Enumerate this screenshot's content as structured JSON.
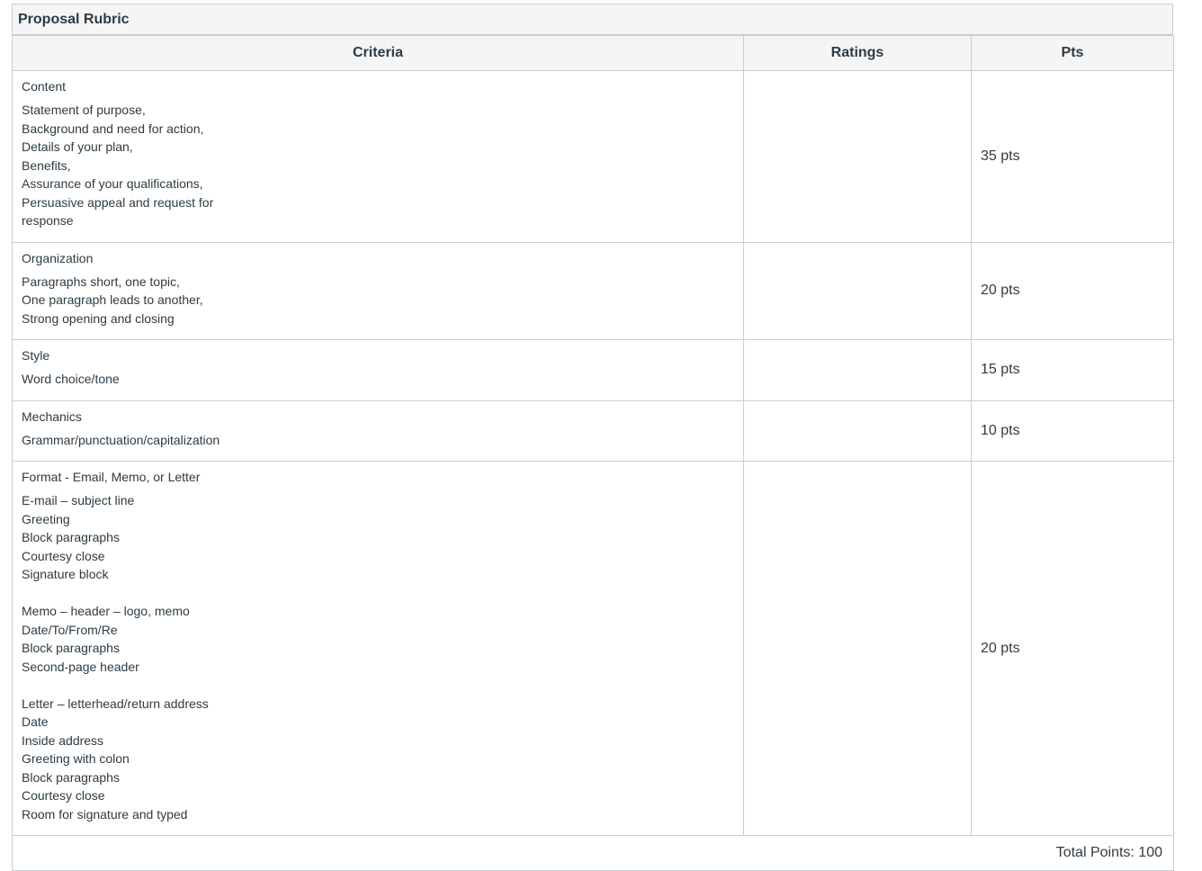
{
  "rubric": {
    "title": "Proposal Rubric",
    "headers": {
      "criteria": "Criteria",
      "ratings": "Ratings",
      "pts": "Pts"
    },
    "rows": [
      {
        "title": "Content",
        "lines": [
          "Statement of purpose,",
          "Background and need for action,",
          "Details of your plan,",
          "Benefits,",
          "Assurance of your qualifications,",
          "Persuasive appeal and request for",
          "response"
        ],
        "pts": "35 pts"
      },
      {
        "title": "Organization",
        "lines": [
          "Paragraphs short, one topic,",
          "One paragraph leads to another,",
          "Strong opening and closing"
        ],
        "pts": "20 pts"
      },
      {
        "title": "Style",
        "lines": [
          "Word choice/tone"
        ],
        "pts": "15 pts"
      },
      {
        "title": "Mechanics",
        "lines": [
          "Grammar/punctuation/capitalization"
        ],
        "pts": "10 pts"
      },
      {
        "title": "Format - Email, Memo, or Letter",
        "lines": [
          "E-mail – subject line",
          "Greeting",
          "Block paragraphs",
          "Courtesy close",
          "Signature block",
          "",
          "Memo – header – logo, memo",
          "Date/To/From/Re",
          "Block paragraphs",
          "Second-page header",
          "",
          "Letter – letterhead/return address",
          "Date",
          "Inside address",
          "Greeting with colon",
          "Block paragraphs",
          "Courtesy close",
          "Room for signature and typed"
        ],
        "pts": "20 pts"
      }
    ],
    "total": "Total Points: 100"
  }
}
